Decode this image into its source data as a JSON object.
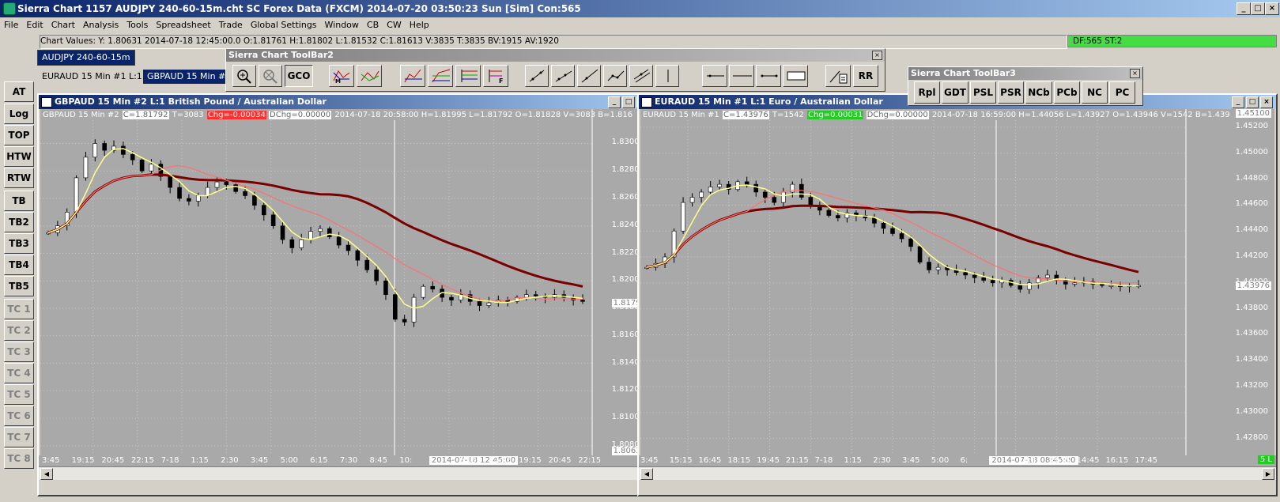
{
  "app": {
    "title": "Sierra Chart 1157 AUDJPY 240-60-15m.cht  SC Forex Data (FXCM) 2014-07-20  03:50:23 Sun [Sim]  Con:565"
  },
  "menu": [
    "File",
    "Edit",
    "Chart",
    "Analysis",
    "Tools",
    "Spreadsheet",
    "Trade",
    "Global Settings",
    "Window",
    "CB",
    "CW",
    "Help"
  ],
  "values_bar": "Chart Values: Y: 1.80631  2014-07-18  12:45:00.0  O:1.81761  H:1.81802  L:1.81532  C:1.81613  V:3835  T:3835  BV:1915  AV:1920",
  "df_status": "DF:565  ST:2",
  "chartbook_tab": "AUDJPY 240-60-15m",
  "chart_tabs": [
    "EURAUD  15 Min   #1  L:1",
    "GBPAUD  15 Min   #2  L:1"
  ],
  "left_buttons": [
    "AT",
    "Log",
    "TOP",
    "HTW",
    "RTW",
    "TB",
    "TB2",
    "TB3",
    "TB4",
    "TB5",
    "TC 1",
    "TC 2",
    "TC 3",
    "TC 4",
    "TC 5",
    "TC 6",
    "TC 7",
    "TC 8"
  ],
  "toolbar2": {
    "title": "Sierra Chart ToolBar2",
    "text_buttons": {
      "gco": "GCO",
      "rr": "RR"
    },
    "icons": [
      "zoom-in-icon",
      "zoom-out-icon",
      "gco",
      "cross-lines-icon",
      "cross-lines-2-icon",
      "bar-draw-icon",
      "bar-draw-2-icon",
      "fib-icon",
      "fib-f-icon",
      "line-icon",
      "ray-icon",
      "extended-line-icon",
      "segment-icon",
      "channel-icon",
      "vertical-line-icon",
      "horizontal-ray-icon",
      "horizontal-line-icon",
      "horizontal-segment-icon",
      "rectangle-icon",
      "calculator-icon",
      "rr"
    ]
  },
  "toolbar3": {
    "title": "Sierra Chart ToolBar3",
    "buttons": [
      "Rpl",
      "GDT",
      "PSL",
      "PSR",
      "NCb",
      "PCb",
      "NC",
      "PC"
    ]
  },
  "colors": {
    "candle_up": "#ffffff",
    "candle_down": "#000000",
    "ma_fast": "#ffff88",
    "ma_mid": "#ff7070",
    "ma_slow": "#7a0000",
    "plot_bg": "#a9a9a9",
    "chg_negative": "#ff3030",
    "chg_positive": "#22cc22"
  },
  "chart_data": [
    {
      "type": "line",
      "window_title": "GBPAUD  15 Min  #2  L:1  British Pound / Australian Dollar",
      "info": {
        "symbol": "GBPAUD  15 Min    #2",
        "c": "C=1.81792",
        "t": "T=3083",
        "chg": "Chg=-0.00034",
        "dchg": "DChg=0.00000",
        "rest": "2014-07-18 20:58:00  H=1.81995  L=1.81792  O=1.81828  V=3083  B=1.816"
      },
      "ylim": [
        1.8073,
        1.8325
      ],
      "y_ticks": [
        "1.83000",
        "1.82800",
        "1.82600",
        "1.82400",
        "1.82200",
        "1.82000",
        "1.81800",
        "1.81600",
        "1.81400",
        "1.81200",
        "1.81000",
        "1.80800"
      ],
      "current_price": "1.81792",
      "bottom_price": "1.80631",
      "x_ticks": [
        "3:45",
        "19:15",
        "20:45",
        "22:15",
        "7-18",
        "1:15",
        "2:30",
        "3:45",
        "5:00",
        "6:15",
        "7:30",
        "8:45",
        "10:",
        "2014-07-18  12:45:00",
        "6:15",
        "17:45",
        "19:15",
        "20:45",
        "22:15"
      ],
      "selected_time": "2014-07-18  12:45:00",
      "corner_badge": "5",
      "series": [
        {
          "name": "",
          "values": [
            1.8235,
            1.824,
            1.825,
            1.8275,
            1.829,
            1.83,
            1.8295,
            1.8298,
            1.8292,
            1.8288,
            1.828,
            1.8285,
            1.8276,
            1.8268,
            1.826,
            1.8258,
            1.8262,
            1.8268,
            1.8272,
            1.827,
            1.8265,
            1.8262,
            1.8255,
            1.8248,
            1.824,
            1.823,
            1.8224,
            1.823,
            1.8236,
            1.8238,
            1.8232,
            1.8226,
            1.8222,
            1.8215,
            1.8208,
            1.82,
            1.819,
            1.8172,
            1.817,
            1.8188,
            1.8196,
            1.8194,
            1.8188,
            1.8186,
            1.819,
            1.8185,
            1.8182,
            1.8184,
            1.8186,
            1.8185,
            1.8188,
            1.819,
            1.8189,
            1.8188,
            1.819,
            1.8188,
            1.8186,
            1.8185
          ]
        }
      ]
    },
    {
      "type": "line",
      "window_title": "EURAUD  15 Min  #1  L:1  Euro / Australian Dollar",
      "info": {
        "symbol": "EURAUD  15 Min    #1",
        "c": "C=1.43976",
        "t": "T=1542",
        "chg": "Chg=0.00031",
        "dchg": "DChg=0.00000",
        "rest": "2014-07-18 16:59:00  H=1.44056  L=1.43927  O=1.43946  V=1542  B=1.439"
      },
      "ylim": [
        1.4267,
        1.4534
      ],
      "y_ticks": [
        "1.45200",
        "1.45000",
        "1.44800",
        "1.44600",
        "1.44400",
        "1.44200",
        "1.44000",
        "1.43800",
        "1.43600",
        "1.43400",
        "1.43200",
        "1.43000",
        "1.42800"
      ],
      "current_price": "1.43976",
      "top_price": "1.45100",
      "x_ticks": [
        "3:45",
        "15:15",
        "16:45",
        "18:15",
        "19:45",
        "21:15",
        "7-18",
        "1:15",
        "2:30",
        "3:45",
        "5:00",
        "6:",
        "2014-07-18  08:45:00",
        "11:45",
        "13:15",
        "14:45",
        "16:15",
        "17:45"
      ],
      "selected_time": "2014-07-18  08:45:00",
      "corner_badge": "5 L",
      "series": [
        {
          "name": "",
          "values": [
            1.4412,
            1.4415,
            1.442,
            1.444,
            1.4462,
            1.4466,
            1.447,
            1.4474,
            1.4476,
            1.4472,
            1.4478,
            1.4476,
            1.447,
            1.4466,
            1.4462,
            1.447,
            1.4476,
            1.4466,
            1.446,
            1.4456,
            1.4452,
            1.445,
            1.4454,
            1.4452,
            1.445,
            1.4446,
            1.4442,
            1.4438,
            1.4434,
            1.4428,
            1.4416,
            1.441,
            1.4412,
            1.441,
            1.4408,
            1.4406,
            1.4404,
            1.4402,
            1.44,
            1.4402,
            1.4398,
            1.4395,
            1.44,
            1.4404,
            1.4406,
            1.4402,
            1.4399,
            1.44,
            1.4401,
            1.4399,
            1.4398,
            1.4398,
            1.4397,
            1.4398,
            1.4398
          ]
        }
      ]
    }
  ]
}
